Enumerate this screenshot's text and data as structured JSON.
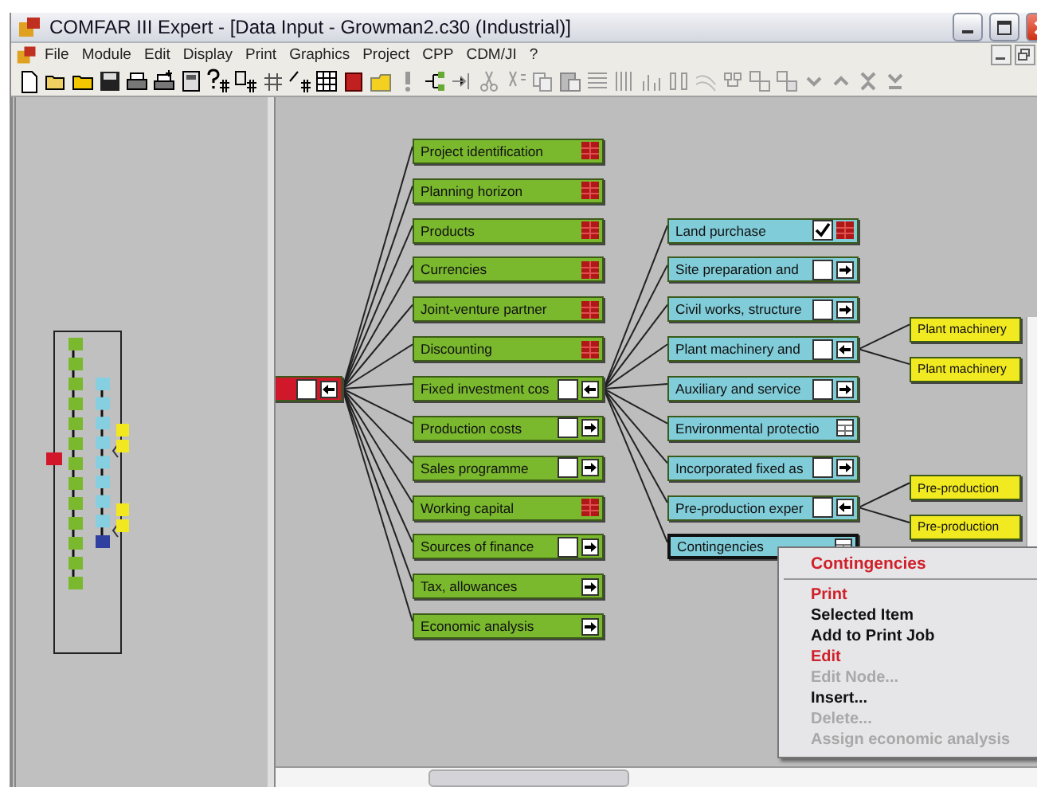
{
  "window": {
    "title": "COMFAR III Expert - [Data Input - Growman2.c30 (Industrial)]"
  },
  "menu": [
    "File",
    "Module",
    "Edit",
    "Display",
    "Print",
    "Graphics",
    "Project",
    "CPP",
    "CDM/JI",
    "?"
  ],
  "tree": {
    "selected": false,
    "checked": false,
    "kind": "collapse",
    "children": [
      {
        "label": "Project identification",
        "selected": false,
        "kind": "table"
      },
      {
        "label": "Planning horizon",
        "selected": false,
        "kind": "table"
      },
      {
        "label": "Products",
        "selected": false,
        "kind": "table"
      },
      {
        "label": "Currencies",
        "selected": false,
        "kind": "table"
      },
      {
        "label": "Joint-venture partner",
        "selected": false,
        "kind": "table"
      },
      {
        "label": "Discounting",
        "selected": false,
        "kind": "table"
      },
      {
        "label": "Fixed investment cos",
        "selected": false,
        "checked": false,
        "kind": "collapse",
        "children": [
          {
            "label": "Land purchase",
            "selected": false,
            "checked": true,
            "kind": "table"
          },
          {
            "label": "Site preparation and",
            "selected": false,
            "checked": false,
            "kind": "expand"
          },
          {
            "label": "Civil works, structure",
            "selected": false,
            "checked": false,
            "kind": "expand"
          },
          {
            "label": "Plant machinery and",
            "selected": false,
            "checked": false,
            "kind": "collapse",
            "children": [
              {
                "label": "Plant machinery",
                "selected": false
              },
              {
                "label": "Plant machinery",
                "selected": false
              }
            ]
          },
          {
            "label": "Auxiliary and service",
            "selected": false,
            "checked": false,
            "kind": "expand"
          },
          {
            "label": "Environmental protectio",
            "selected": false,
            "kind": "plain-table"
          },
          {
            "label": "Incorporated fixed as",
            "selected": false,
            "checked": false,
            "kind": "expand"
          },
          {
            "label": "Pre-production exper",
            "selected": false,
            "checked": false,
            "kind": "collapse",
            "children": [
              {
                "label": "Pre-production",
                "selected": false
              },
              {
                "label": "Pre-production",
                "selected": false
              }
            ]
          },
          {
            "label": "Contingencies",
            "selected": true,
            "kind": "plain-table"
          }
        ]
      },
      {
        "label": "Production costs",
        "selected": false,
        "checked": false,
        "kind": "expand"
      },
      {
        "label": "Sales programme",
        "selected": false,
        "checked": false,
        "kind": "expand"
      },
      {
        "label": "Working capital",
        "selected": false,
        "kind": "table"
      },
      {
        "label": "Sources of finance",
        "selected": false,
        "checked": false,
        "kind": "expand"
      },
      {
        "label": "Tax, allowances",
        "selected": false,
        "kind": "expand"
      },
      {
        "label": "Economic analysis",
        "selected": false,
        "kind": "expand"
      }
    ]
  },
  "context_menu": {
    "title": "Contingencies",
    "items": [
      {
        "label": "Print",
        "kind": "header",
        "disabled": false
      },
      {
        "label": "Selected Item",
        "kind": "item",
        "disabled": false
      },
      {
        "label": "Add to Print Job",
        "kind": "item",
        "disabled": false
      },
      {
        "label": "Edit",
        "kind": "header",
        "disabled": false
      },
      {
        "label": "Edit Node...",
        "kind": "item",
        "disabled": true
      },
      {
        "label": "Insert...",
        "kind": "item",
        "disabled": false
      },
      {
        "label": "Delete...",
        "kind": "item",
        "disabled": true
      },
      {
        "label": "Assign economic analysis",
        "kind": "item",
        "disabled": true
      }
    ]
  }
}
